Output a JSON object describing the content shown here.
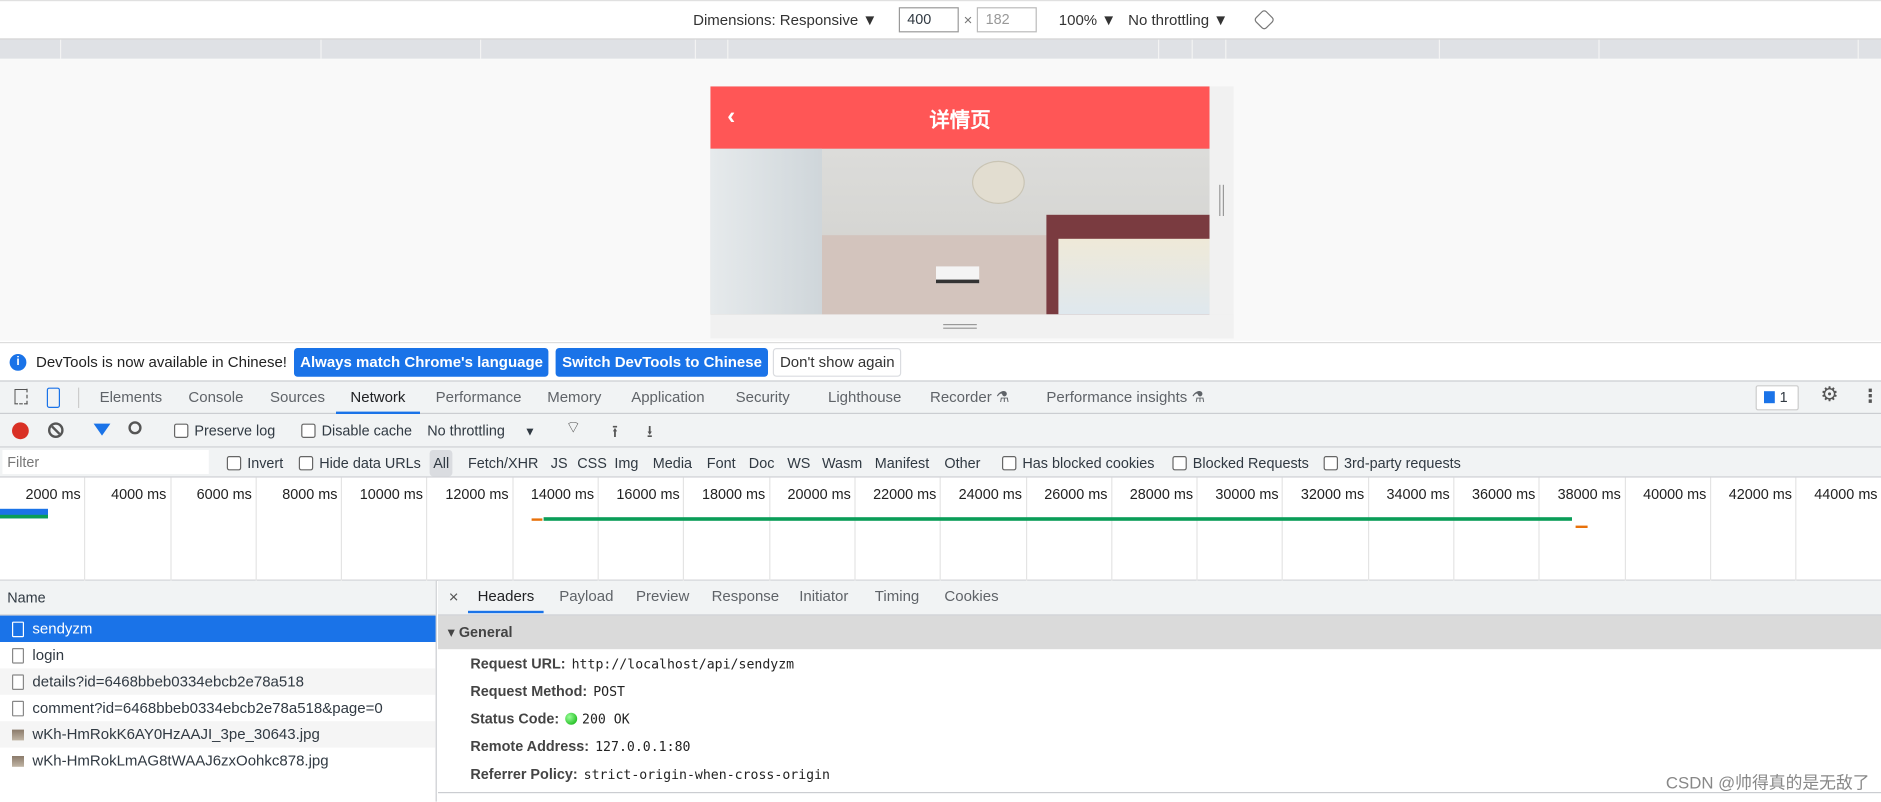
{
  "device_toolbar": {
    "dimensions": "Dimensions: Responsive ▼",
    "width": "400",
    "times": "×",
    "height": "182",
    "zoom": "100% ▼",
    "throttling": "No throttling ▼",
    "rotate_icon": "rotate-icon"
  },
  "page": {
    "title": "详情页",
    "back": "‹",
    "header_color": "#ff5656"
  },
  "infobar": {
    "message": "DevTools is now available in Chinese!",
    "btn_match": "Always match Chrome's language",
    "btn_switch": "Switch DevTools to Chinese",
    "btn_dont": "Don't show again"
  },
  "tabs": [
    "Elements",
    "Console",
    "Sources",
    "Network",
    "Performance",
    "Memory",
    "Application",
    "Security",
    "Lighthouse",
    "Recorder ⚗",
    "Performance insights ⚗"
  ],
  "active_tab": "Network",
  "issues_count": "1",
  "network_toolbar": {
    "preserve_log": "Preserve log",
    "disable_cache": "Disable cache",
    "throttling": "No throttling"
  },
  "filter": {
    "placeholder": "Filter",
    "invert": "Invert",
    "hide_data_urls": "Hide data URLs",
    "types": [
      "All",
      "Fetch/XHR",
      "JS",
      "CSS",
      "Img",
      "Media",
      "Font",
      "Doc",
      "WS",
      "Wasm",
      "Manifest",
      "Other"
    ],
    "has_blocked_cookies": "Has blocked cookies",
    "blocked_requests": "Blocked Requests",
    "third_party": "3rd-party requests"
  },
  "timeline": {
    "ticks": [
      "2000 ms",
      "4000 ms",
      "6000 ms",
      "8000 ms",
      "10000 ms",
      "12000 ms",
      "14000 ms",
      "16000 ms",
      "18000 ms",
      "20000 ms",
      "22000 ms",
      "24000 ms",
      "26000 ms",
      "28000 ms",
      "30000 ms",
      "32000 ms",
      "34000 ms",
      "36000 ms",
      "38000 ms",
      "40000 ms",
      "42000 ms",
      "44000 ms"
    ]
  },
  "requests": {
    "header": "Name",
    "items": [
      {
        "name": "sendyzm",
        "type": "doc"
      },
      {
        "name": "login",
        "type": "doc"
      },
      {
        "name": "details?id=6468bbeb0334ebcb2e78a518",
        "type": "doc"
      },
      {
        "name": "comment?id=6468bbeb0334ebcb2e78a518&page=0",
        "type": "doc"
      },
      {
        "name": "wKh-HmRokK6AY0HzAAJI_3pe_30643.jpg",
        "type": "img"
      },
      {
        "name": "wKh-HmRokLmAG8tWAAJ6zxOohkc878.jpg",
        "type": "img"
      }
    ]
  },
  "detail": {
    "close": "×",
    "tabs": [
      "Headers",
      "Payload",
      "Preview",
      "Response",
      "Initiator",
      "Timing",
      "Cookies"
    ],
    "active_tab": "Headers",
    "section": "▾ General",
    "fields": [
      {
        "k": "Request URL:",
        "v": "http://localhost/api/sendyzm"
      },
      {
        "k": "Request Method:",
        "v": "POST"
      },
      {
        "k": "Status Code:",
        "v": "200 OK"
      },
      {
        "k": "Remote Address:",
        "v": "127.0.0.1:80"
      },
      {
        "k": "Referrer Policy:",
        "v": "strict-origin-when-cross-origin"
      }
    ]
  },
  "watermark": "CSDN @帅得真的是无敌了"
}
